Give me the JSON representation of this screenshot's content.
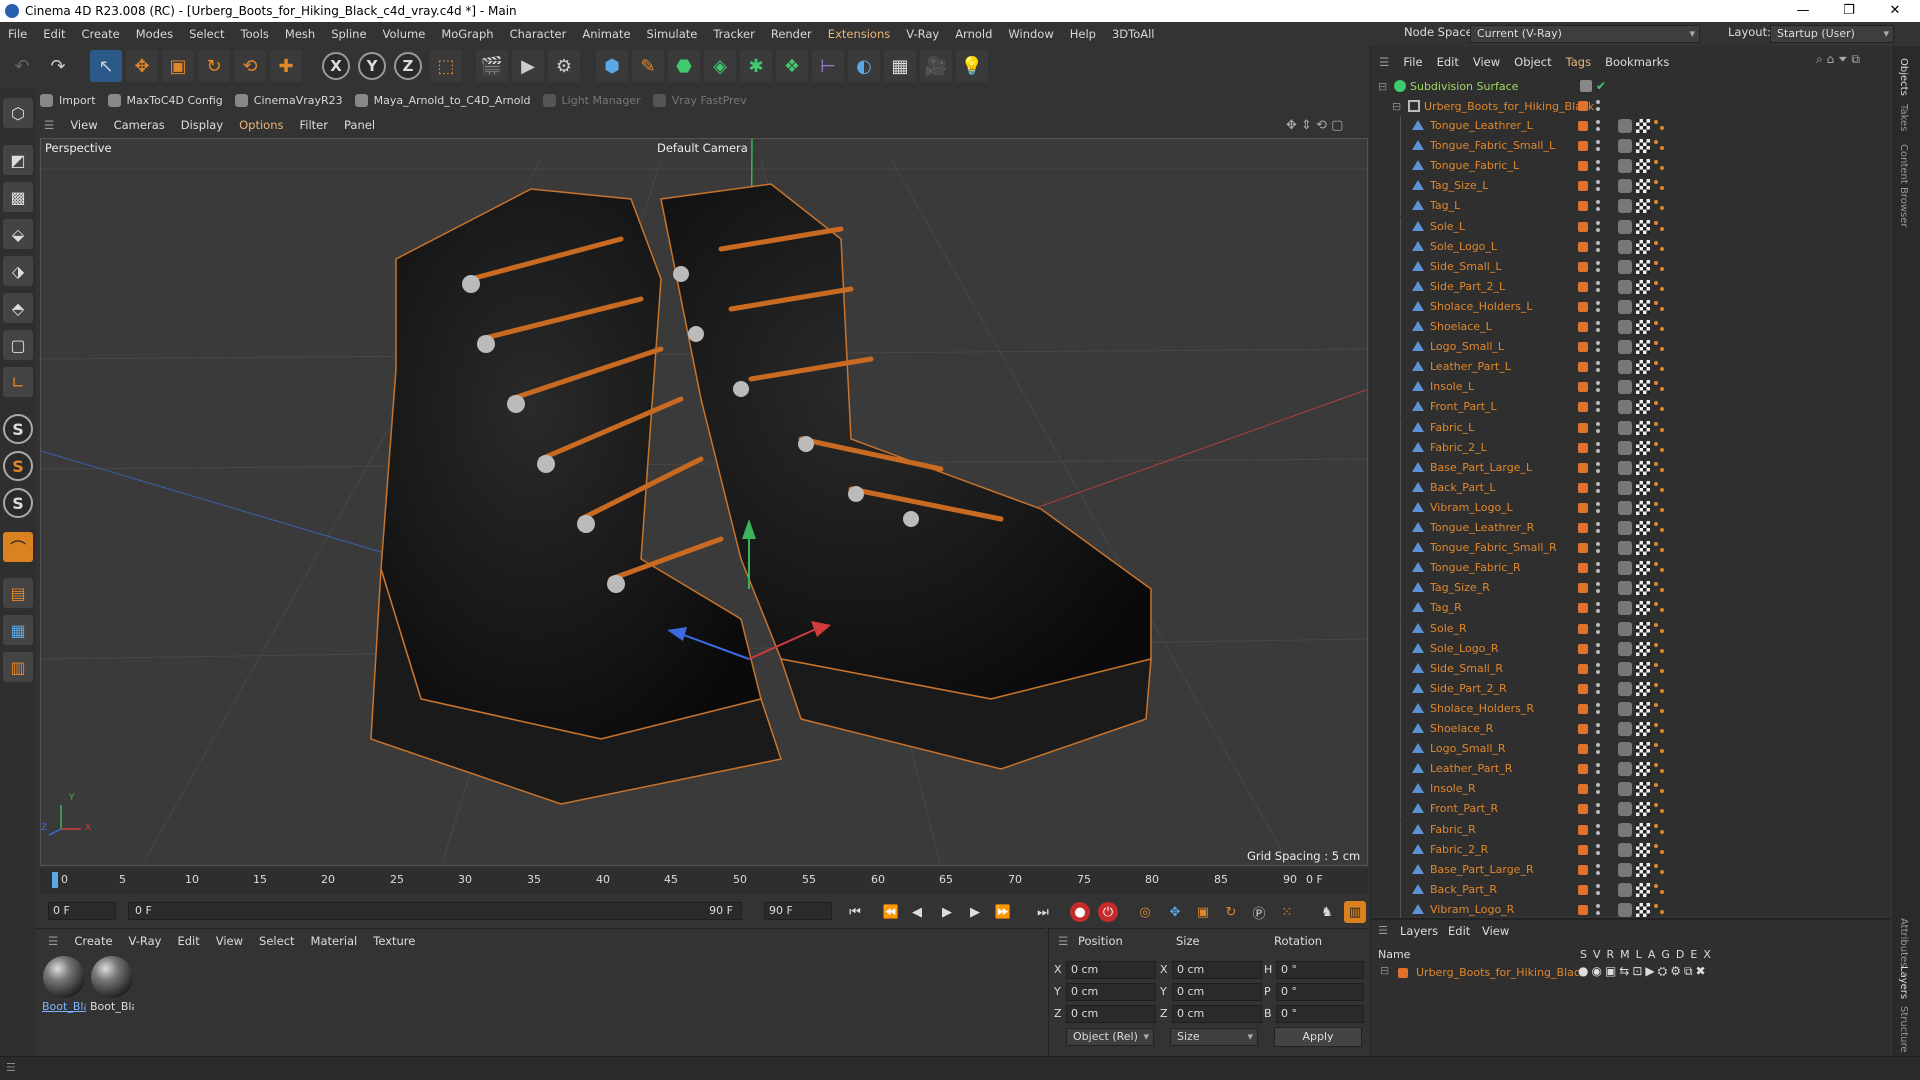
{
  "window": {
    "title": "Cinema 4D R23.008 (RC) - [Urberg_Boots_for_Hiking_Black_c4d_vray.c4d *] - Main",
    "controls": [
      "—",
      "❐",
      "✕"
    ]
  },
  "menu": [
    "File",
    "Edit",
    "Create",
    "Modes",
    "Select",
    "Tools",
    "Mesh",
    "Spline",
    "Volume",
    "MoGraph",
    "Character",
    "Animate",
    "Simulate",
    "Tracker",
    "Render",
    "Extensions",
    "V-Ray",
    "Arnold",
    "Window",
    "Help",
    "3DToAll"
  ],
  "node_space": {
    "label": "Node Space:",
    "value": "Current (V-Ray)"
  },
  "layout": {
    "label": "Layout:",
    "value": "Startup (User)"
  },
  "plugins": [
    {
      "label": "Import",
      "dim": false
    },
    {
      "label": "MaxToC4D Config",
      "dim": false
    },
    {
      "label": "CinemaVrayR23",
      "dim": false
    },
    {
      "label": "Maya_Arnold_to_C4D_Arnold",
      "dim": false
    },
    {
      "label": "Light Manager",
      "dim": true
    },
    {
      "label": "Vray FastPrev",
      "dim": true
    }
  ],
  "viewport_menu": [
    "View",
    "Cameras",
    "Display",
    "Options",
    "Filter",
    "Panel"
  ],
  "viewport": {
    "label": "Perspective",
    "camera": "Default Camera",
    "grid_spacing": "Grid Spacing : 5 cm",
    "axis_y": "Y",
    "axis_x": "X",
    "axis_z": "Z"
  },
  "timeline": {
    "ticks": [
      "0",
      "5",
      "10",
      "15",
      "20",
      "25",
      "30",
      "35",
      "40",
      "45",
      "50",
      "55",
      "60",
      "65",
      "70",
      "75",
      "80",
      "85",
      "90"
    ],
    "current": "0 F",
    "start": "0 F",
    "range_start": "0 F",
    "range_end": "90 F",
    "end": "90 F"
  },
  "material_menu": [
    "Create",
    "V-Ray",
    "Edit",
    "View",
    "Select",
    "Material",
    "Texture"
  ],
  "materials": [
    {
      "label": "Boot_Bla",
      "selected": true
    },
    {
      "label": "Boot_Bla",
      "selected": false
    }
  ],
  "coords": {
    "headers": [
      "Position",
      "Size",
      "Rotation"
    ],
    "rows": [
      {
        "axis": "X",
        "pos": "0 cm",
        "size_axis": "X",
        "size": "0 cm",
        "rot_axis": "H",
        "rot": "0 °"
      },
      {
        "axis": "Y",
        "pos": "0 cm",
        "size_axis": "Y",
        "size": "0 cm",
        "rot_axis": "P",
        "rot": "0 °"
      },
      {
        "axis": "Z",
        "pos": "0 cm",
        "size_axis": "Z",
        "size": "0 cm",
        "rot_axis": "B",
        "rot": "0 °"
      }
    ],
    "mode": "Object (Rel)",
    "size_mode": "Size",
    "apply": "Apply"
  },
  "object_menu": [
    "File",
    "Edit",
    "View",
    "Object",
    "Tags",
    "Bookmarks"
  ],
  "objects": {
    "root": "Subdivision Surface",
    "group": "Urberg_Boots_for_Hiking_Black",
    "children": [
      "Tongue_Leathrer_L",
      "Tongue_Fabric_Small_L",
      "Tongue_Fabric_L",
      "Tag_Size_L",
      "Tag_L",
      "Sole_L",
      "Sole_Logo_L",
      "Side_Small_L",
      "Side_Part_2_L",
      "Sholace_Holders_L",
      "Shoelace_L",
      "Logo_Small_L",
      "Leather_Part_L",
      "Insole_L",
      "Front_Part_L",
      "Fabric_L",
      "Fabric_2_L",
      "Base_Part_Large_L",
      "Back_Part_L",
      "Vibram_Logo_L",
      "Tongue_Leathrer_R",
      "Tongue_Fabric_Small_R",
      "Tongue_Fabric_R",
      "Tag_Size_R",
      "Tag_R",
      "Sole_R",
      "Sole_Logo_R",
      "Side_Small_R",
      "Side_Part_2_R",
      "Sholace_Holders_R",
      "Shoelace_R",
      "Logo_Small_R",
      "Leather_Part_R",
      "Insole_R",
      "Front_Part_R",
      "Fabric_R",
      "Fabric_2_R",
      "Base_Part_Large_R",
      "Back_Part_R",
      "Vibram_Logo_R"
    ]
  },
  "layers": {
    "menu": [
      "Layers",
      "Edit",
      "View"
    ],
    "name_header": "Name",
    "columns": [
      "S",
      "V",
      "R",
      "M",
      "L",
      "A",
      "G",
      "D",
      "E",
      "X"
    ],
    "items": [
      "Urberg_Boots_for_Hiking_Black"
    ]
  },
  "side_tabs": [
    "Objects",
    "Takes",
    "Content Browser",
    "Attributes",
    "Layers",
    "Structure"
  ],
  "colors": {
    "accent": "#e0872b",
    "bg": "#333333",
    "selection": "#2b5a8a"
  }
}
